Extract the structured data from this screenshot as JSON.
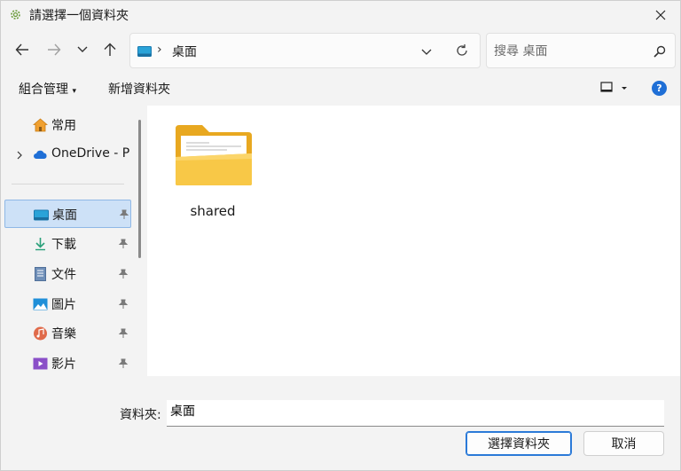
{
  "window": {
    "title": "請選擇一個資料夾"
  },
  "address": {
    "path": "桌面"
  },
  "search": {
    "placeholder": "搜尋 桌面"
  },
  "commands": {
    "organize": "組合管理",
    "new_folder": "新增資料夾"
  },
  "help": {
    "label": "?"
  },
  "sidebar": {
    "items": [
      {
        "label": "常用",
        "icon": "home-icon"
      },
      {
        "label": "OneDrive - P",
        "icon": "cloud-icon"
      },
      {
        "label": "桌面",
        "icon": "desktop-icon",
        "pinned": true,
        "selected": true
      },
      {
        "label": "下載",
        "icon": "download-icon",
        "pinned": true
      },
      {
        "label": "文件",
        "icon": "document-icon",
        "pinned": true
      },
      {
        "label": "圖片",
        "icon": "picture-icon",
        "pinned": true
      },
      {
        "label": "音樂",
        "icon": "music-icon",
        "pinned": true
      },
      {
        "label": "影片",
        "icon": "video-icon",
        "pinned": true
      }
    ]
  },
  "files": [
    {
      "name": "shared",
      "icon": "folder-icon"
    }
  ],
  "footer": {
    "folder_label": "資料夾:",
    "folder_value": "桌面",
    "select_button": "選擇資料夾",
    "cancel_button": "取消"
  },
  "colors": {
    "accent": "#1f6fd6",
    "selection": "#cde1f7",
    "folder": "#f8c847"
  }
}
